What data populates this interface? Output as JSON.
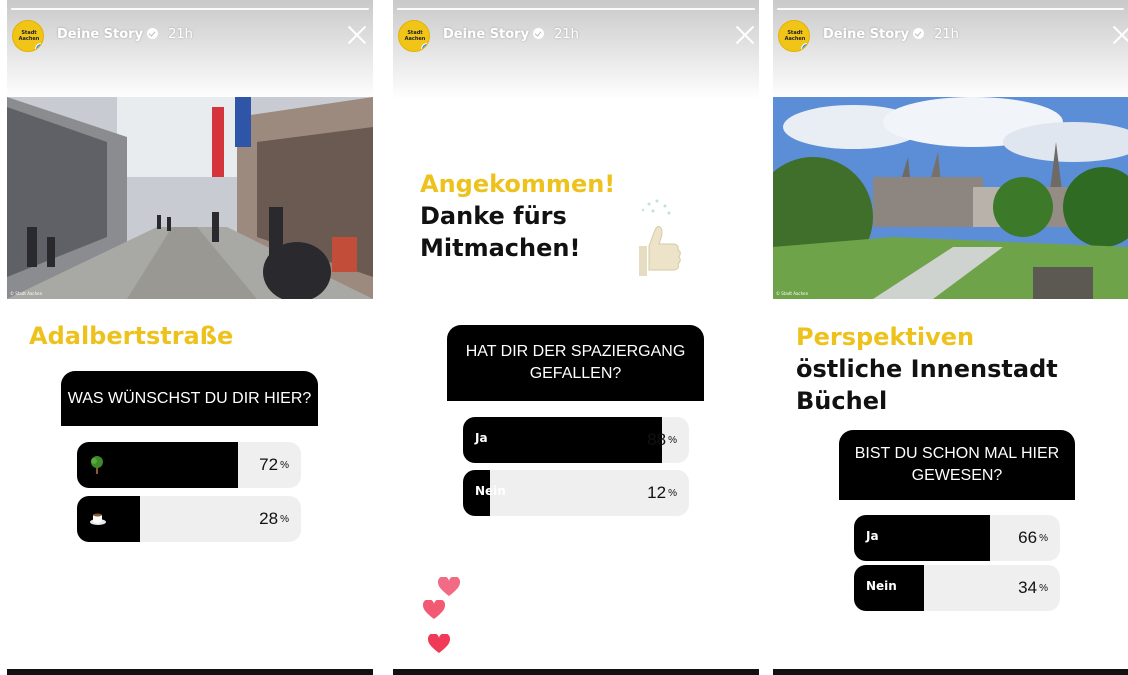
{
  "stories": [
    {
      "account": "Deine Story",
      "time": "21h",
      "avatar_text": "Stadt Aachen",
      "headline_yellow": "Adalbertstraße",
      "headline_black": [],
      "question": "WAS WÜNSCHST DU DIR HIER?",
      "options": [
        {
          "label": "",
          "icon": "tree-icon",
          "percent": 72
        },
        {
          "label": "",
          "icon": "coffee-icon",
          "percent": 28
        }
      ]
    },
    {
      "account": "Deine Story",
      "time": "21h",
      "avatar_text": "Stadt Aachen",
      "headline_yellow": "Angekommen!",
      "headline_black": [
        "Danke fürs",
        "Mitmachen!"
      ],
      "question": [
        "HAT DIR DER SPAZIERGANG",
        "GEFALLEN?"
      ],
      "options": [
        {
          "label": "Ja",
          "percent": 88
        },
        {
          "label": "Nein",
          "percent": 12
        }
      ]
    },
    {
      "account": "Deine Story",
      "time": "21h",
      "avatar_text": "Stadt Aachen",
      "headline_yellow": "Perspektiven",
      "headline_black": [
        "östliche Innenstadt",
        "Büchel"
      ],
      "question": [
        "BIST DU SCHON MAL HIER",
        "GEWESEN?"
      ],
      "options": [
        {
          "label": "Ja",
          "percent": 66
        },
        {
          "label": "Nein",
          "percent": 34
        }
      ]
    }
  ],
  "pct_symbol": "%",
  "colors": {
    "accent_yellow": "#eec21c",
    "poll_black": "#000000",
    "poll_track": "#efefef",
    "heart": "#f2455e"
  }
}
